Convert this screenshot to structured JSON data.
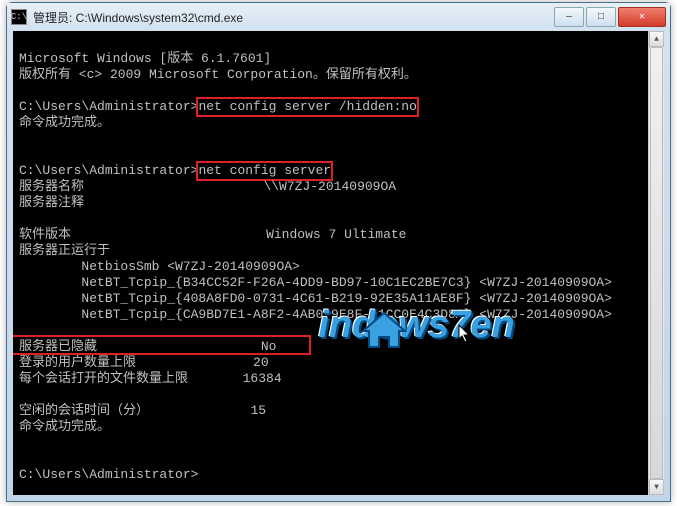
{
  "window": {
    "title": "管理员: C:\\Windows\\system32\\cmd.exe",
    "icon_glyph": "C:\\"
  },
  "buttons": {
    "min": "—",
    "max": "□",
    "close": "✕"
  },
  "terminal": {
    "line1": "Microsoft Windows [版本 6.1.7601]",
    "line2": "版权所有 <c> 2009 Microsoft Corporation。保留所有权利。",
    "prompt1_prefix": "C:\\Users\\Administrator>",
    "prompt1_cmd": "net config server /hidden:no",
    "done1": "命令成功完成。",
    "prompt2_prefix": "C:\\Users\\Administrator>",
    "prompt2_cmd": "net config server",
    "srv_name_label": "服务器名称",
    "srv_name_value": "\\\\W7ZJ-20140909OA",
    "srv_comment_label": "服务器注释",
    "sw_ver_label": "软件版本",
    "sw_ver_value": "Windows 7 Ultimate",
    "running_label": "服务器正运行于",
    "net_line1": "        NetbiosSmb <W7ZJ-20140909OA>",
    "net_line2": "        NetBT_Tcpip_{B34CC52F-F26A-4DD9-BD97-10C1EC2BE7C3} <W7ZJ-20140909OA>",
    "net_line3": "        NetBT_Tcpip_{408A8FD0-0731-4C61-B219-92E35A11AE8F} <W7ZJ-20140909OA>",
    "net_line4": "        NetBT_Tcpip_{CA9BD7E1-A8F2-4AB0-9E8F-51CC0E4C3D8A} <W7ZJ-20140909OA>",
    "hidden_label": "服务器已隐藏",
    "hidden_value": "No",
    "max_users_label": "登录的用户数量上限",
    "max_users_value": "20",
    "max_files_label": "每个会话打开的文件数量上限",
    "max_files_value": "16384",
    "idle_label": "空闲的会话时间（分）",
    "idle_value": "15",
    "done2": "命令成功完成。",
    "prompt3": "C:\\Users\\Administrator>"
  },
  "watermark": {
    "text": "indows7en"
  }
}
